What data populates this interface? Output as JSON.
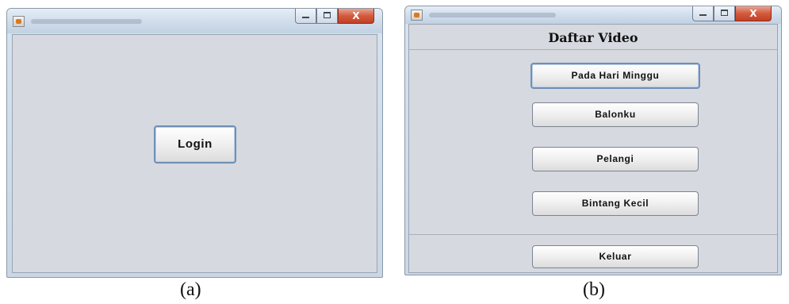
{
  "panel_a": {
    "login_label": "Login",
    "caption": "(a)"
  },
  "panel_b": {
    "heading": "Daftar Video",
    "videos": [
      {
        "label": "Pada Hari Minggu"
      },
      {
        "label": "Balonku"
      },
      {
        "label": "Pelangi"
      },
      {
        "label": "Bintang Kecil"
      }
    ],
    "exit_label": "Keluar",
    "caption": "(b)"
  },
  "window_controls": {
    "close_glyph": "X"
  },
  "icons": [
    "java-app-icon",
    "minimize-icon",
    "maximize-icon",
    "close-icon"
  ]
}
